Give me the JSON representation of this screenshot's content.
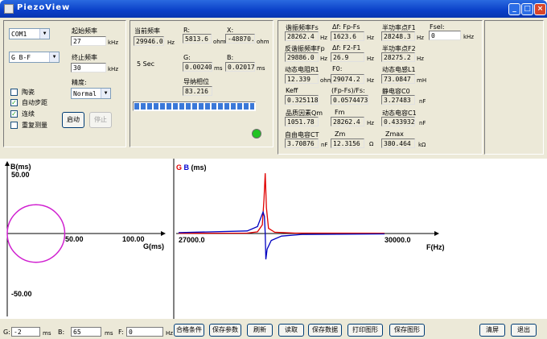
{
  "window": {
    "title": "PiezoView",
    "min_symbol": "_",
    "max_symbol": "□",
    "close_symbol": "×"
  },
  "left_panel": {
    "port": "COM1",
    "channel": "G B-F",
    "start_freq_label": "起始频率",
    "start_freq_value": "27",
    "stop_freq_label": "终止频率",
    "stop_freq_value": "30",
    "freq_unit": "kHz",
    "precision_label": "精度:",
    "precision_value": "Normal",
    "checkboxes": [
      {
        "label": "陶瓷",
        "checked": false
      },
      {
        "label": "自动步距",
        "checked": true
      },
      {
        "label": "连续",
        "checked": true
      },
      {
        "label": "重复测量",
        "checked": false
      }
    ],
    "start_button": "启动",
    "stop_button": "停止"
  },
  "mid_panel": {
    "current_freq_label": "当前频率",
    "current_freq_value": "29946.0",
    "current_freq_unit": "Hz",
    "r_label": "R:",
    "r_value": "5813.6",
    "r_unit": "ohm",
    "x_label": "X:",
    "x_value": "-48870.2",
    "x_unit": "ohm",
    "interval": "5 Sec",
    "g_label": "G:",
    "g_value": "0.002400",
    "g_unit": "ms",
    "b_label": "B:",
    "b_value": "0.020176",
    "b_unit": "ms",
    "phase_label": "导纳相位",
    "phase_value": "83.216",
    "progress": 1.0,
    "status_color": "#22c322"
  },
  "right_panel": {
    "fs_label": "谐振频率Fs",
    "fs_value": "28262.4",
    "fs_unit": "Hz",
    "dfpfs_label": "Δf: Fp-Fs",
    "dfpfs_value": "1623.6",
    "dfpfs_unit": "Hz",
    "f1_label": "半功率点F1",
    "f1_value": "28248.3",
    "f1_unit": "Hz",
    "fsel_label": "Fsel:",
    "fsel_value": "0",
    "fsel_unit": "kHz",
    "fp_label": "反谐振频率Fp",
    "fp_value": "29886.0",
    "fp_unit": "Hz",
    "df21_label": "Δf: F2-F1",
    "df21_value": "26.9",
    "df21_unit": "Hz",
    "f2_label": "半功率点F2",
    "f2_value": "28275.2",
    "f2_unit": "Hz",
    "r1_label": "动态电阻R1",
    "r1_value": "12.339",
    "r1_unit": "ohm",
    "f0_label": "F0:",
    "f0_value": "29074.2",
    "f0_unit": "Hz",
    "l1_label": "动态电感L1",
    "l1_value": "73.0847",
    "l1_unit": "mH",
    "keff_label": "Keff",
    "keff_value": "0.325118",
    "ratio_label": "(Fp-Fs)/Fs:",
    "ratio_value": "0.0574473",
    "c0_label": "静电容C0",
    "c0_value": "3.27483",
    "c0_unit": "nF",
    "qm_label": "品质因素Qm",
    "qm_value": "1051.78",
    "fm_label": "Fm",
    "fm_value": "28262.4",
    "fm_unit": "Hz",
    "c1_label": "动态电容C1",
    "c1_value": "0.433932",
    "c1_unit": "nF",
    "ct_label": "自由电容CT",
    "ct_value": "3.70876",
    "ct_unit": "nF",
    "zm_label": "Zm",
    "zm_value": "12.3156",
    "zm_unit": "Ω",
    "zmax_label": "Zmax",
    "zmax_value": "380.464",
    "zmax_unit": "kΩ"
  },
  "chart_data": [
    {
      "type": "line",
      "title": "",
      "ylabel": "B(ms)",
      "xlabel": "G(ms)",
      "xticks": [
        "50.00",
        "100.00"
      ],
      "yticks": [
        "50.00",
        "-50.00"
      ],
      "xlim": [
        -15,
        120
      ],
      "ylim": [
        -65,
        65
      ],
      "series": [
        {
          "color": "#d020d0",
          "shape": "circle",
          "center": [
            25,
            0
          ],
          "radius": 25
        }
      ]
    },
    {
      "type": "line",
      "title": "",
      "ylabel": "G B (ms)",
      "ylabel_parts": [
        {
          "text": "G",
          "color": "#e00000"
        },
        {
          "text": "B",
          "color": "#0000d0"
        },
        {
          "text": "(ms)",
          "color": "#000000"
        }
      ],
      "xlabel": "F(Hz)",
      "xticks": [
        "27000.0",
        "30000.0"
      ],
      "xlim": [
        27000,
        30600
      ],
      "ylim": [
        -45,
        75
      ],
      "series": [
        {
          "color": "#e00000",
          "x": [
            27000,
            28000,
            28150,
            28220,
            28245,
            28262,
            28280,
            28310,
            28400,
            28700,
            30000
          ],
          "y": [
            0.3,
            0.5,
            2,
            10,
            40,
            70,
            30,
            6,
            1.5,
            0.5,
            0.3
          ]
        },
        {
          "color": "#0000c0",
          "x": [
            27000,
            28000,
            28150,
            28230,
            28250,
            28262,
            28272,
            28290,
            28350,
            28500,
            28800,
            30000
          ],
          "y": [
            1,
            3,
            8,
            25,
            20,
            0,
            -30,
            -18,
            -8,
            -3,
            -1,
            -0.5
          ]
        }
      ]
    }
  ],
  "bottom": {
    "g_label": "G:",
    "g_value": "-2",
    "g_unit": "ms",
    "b_label": "B:",
    "b_value": "65",
    "b_unit": "ms",
    "f_label": "F:",
    "f_value": "0",
    "f_unit": "Hz",
    "buttons": [
      "合格条件",
      "保存参数",
      "刷新",
      "读取",
      "保存数据",
      "打印图形",
      "保存图形",
      "清屏",
      "退出"
    ]
  }
}
